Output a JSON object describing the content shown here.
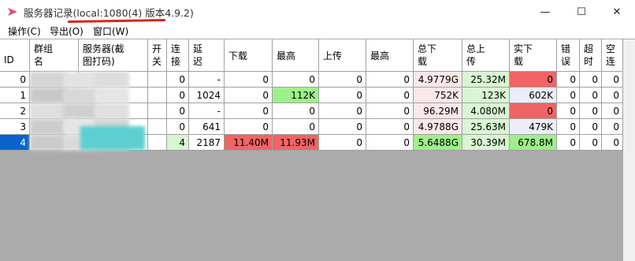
{
  "window": {
    "title": "服务器记录(local:1080(4) 版本4.9.2)",
    "minimize": "—",
    "maximize": "☐",
    "close": "✕",
    "accent": "#d9261c"
  },
  "menu": [
    "操作(C)",
    "导出(O)",
    "窗口(W)"
  ],
  "table": {
    "headers": [
      "ID",
      "群组名",
      "服务器(截图打码)",
      "开关",
      "连接",
      "延迟",
      "下载",
      "最高",
      "上传",
      "最高",
      "总下载",
      "总上传",
      "实下载",
      "错误",
      "超时",
      "空连"
    ],
    "rows": [
      [
        "0",
        "",
        "",
        "",
        "0",
        "-",
        "0",
        "0",
        "0",
        "0",
        "4.9779G",
        "25.32M",
        "0",
        "0",
        "0",
        "0"
      ],
      [
        "1",
        "",
        "",
        "",
        "0",
        "1024",
        "0",
        "112K",
        "0",
        "0",
        "752K",
        "123K",
        "602K",
        "0",
        "0",
        "0"
      ],
      [
        "2",
        "",
        "",
        "",
        "0",
        "-",
        "0",
        "0",
        "0",
        "0",
        "96.29M",
        "4.080M",
        "0",
        "0",
        "0",
        "0"
      ],
      [
        "3",
        "",
        "",
        "",
        "0",
        "641",
        "0",
        "0",
        "0",
        "0",
        "4.9788G",
        "25.63M",
        "479K",
        "0",
        "0",
        "0"
      ],
      [
        "4",
        "",
        "",
        "",
        "4",
        "2187",
        "11.40M",
        "11.93M",
        "0",
        "0",
        "5.6488G",
        "30.39M",
        "678.8M",
        "0",
        "0",
        "0"
      ]
    ],
    "selected_row": 4
  },
  "colors": {
    "selected": "#0a64cc",
    "red": "#f06464",
    "green": "#9ef08a",
    "light_green": "#d8f6d2",
    "light_pink": "#fbe8ea",
    "lavender": "#ededfa",
    "teal": "#5ccfd0"
  }
}
